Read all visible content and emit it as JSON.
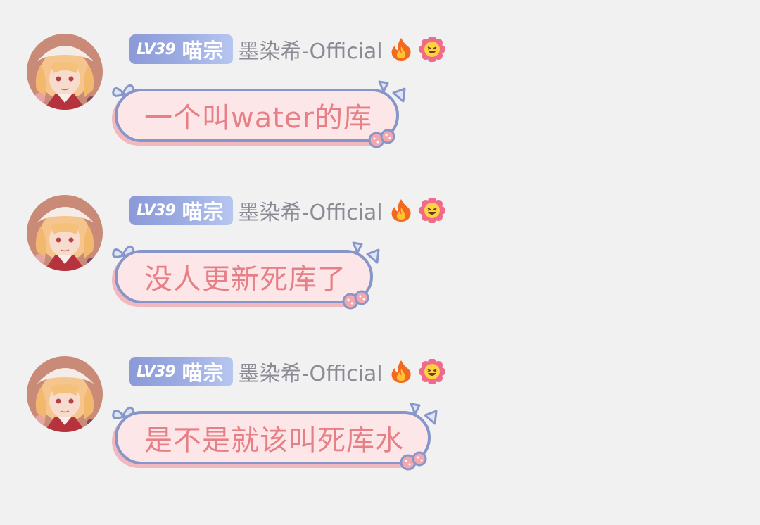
{
  "colors": {
    "background": "#f1f1f1",
    "badge_gradient_start": "#8b9ad8",
    "badge_gradient_end": "#b7c6f0",
    "username": "#8b8b96",
    "bubble_fill": "#fde6e8",
    "bubble_border": "#8796c9",
    "bubble_text": "#e77f86"
  },
  "messages": [
    {
      "avatar_icon": "anime-girl-avatar",
      "level_tag": "LV39",
      "level_title": "喵宗",
      "username": "墨染希-Official",
      "badges": [
        "fire-icon",
        "grinning-flower-icon"
      ],
      "text": "一个叫water的库"
    },
    {
      "avatar_icon": "anime-girl-avatar",
      "level_tag": "LV39",
      "level_title": "喵宗",
      "username": "墨染希-Official",
      "badges": [
        "fire-icon",
        "grinning-flower-icon"
      ],
      "text": "没人更新死库了"
    },
    {
      "avatar_icon": "anime-girl-avatar",
      "level_tag": "LV39",
      "level_title": "喵宗",
      "username": "墨染希-Official",
      "badges": [
        "fire-icon",
        "grinning-flower-icon"
      ],
      "text": "是不是就该叫死库水"
    }
  ]
}
